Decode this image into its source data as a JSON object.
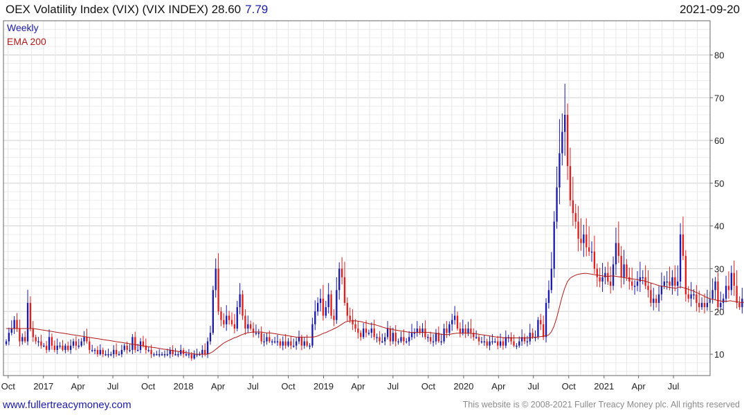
{
  "header": {
    "title": "OEX Volatility Index (VIX) (VIX INDEX) 28.60",
    "change": "7.79",
    "date": "2021-09-20"
  },
  "footer": {
    "site": "www.fullertreacymoney.com",
    "copyright": "This website is © 2008-2021 Fuller Treacy Money plc. All rights reserved"
  },
  "colors": {
    "up": "#1a1aa8",
    "down": "#dd1f1f",
    "ema": "#b01818",
    "grid": "#dcdcdc",
    "link": "#1a1aa8",
    "change": "#1a1aa8"
  },
  "chart_data": {
    "type": "candlestick",
    "legend": [
      {
        "label": "Weekly",
        "color": "#1a1aa8"
      },
      {
        "label": "EMA 200",
        "color": "#b01818"
      }
    ],
    "y_ticks": [
      10,
      20,
      30,
      40,
      50,
      60,
      70,
      80
    ],
    "ylim": [
      5,
      88
    ],
    "x_ticks": [
      "Oct",
      "2017",
      "Apr",
      "Jul",
      "Oct",
      "2018",
      "Apr",
      "Jul",
      "Oct",
      "2019",
      "Apr",
      "Jul",
      "Oct",
      "2020",
      "Apr",
      "Jul",
      "Oct",
      "2021",
      "Apr",
      "Jul"
    ],
    "grid": true,
    "x_start": "2016-09-26",
    "x_end": "2021-09-20",
    "weekly_close": [
      13,
      15,
      16,
      18,
      16,
      13,
      14,
      13,
      22,
      16,
      14,
      13,
      13,
      12,
      12,
      11,
      14,
      12,
      11,
      12,
      12,
      11,
      12,
      11,
      12,
      13,
      12,
      12,
      13,
      14,
      13,
      11,
      11,
      11,
      10,
      11,
      10,
      10,
      10,
      10,
      11,
      10,
      10,
      11,
      12,
      11,
      11,
      14,
      11,
      11,
      13,
      12,
      11,
      11,
      10,
      10,
      10,
      10,
      10,
      10,
      10,
      11,
      10,
      10,
      10,
      11,
      10,
      10,
      10,
      9,
      10,
      10,
      10,
      11,
      10,
      13,
      15,
      25,
      30,
      20,
      18,
      17,
      19,
      18,
      17,
      16,
      21,
      24,
      19,
      16,
      17,
      16,
      15,
      15,
      15,
      13,
      13,
      14,
      13,
      13,
      13,
      13,
      12,
      13,
      12,
      13,
      12,
      12,
      13,
      14,
      12,
      13,
      12,
      12,
      17,
      20,
      22,
      23,
      19,
      21,
      24,
      19,
      18,
      25,
      30,
      28,
      22,
      19,
      18,
      17,
      16,
      15,
      14,
      16,
      15,
      15,
      16,
      14,
      14,
      13,
      13,
      14,
      16,
      13,
      15,
      13,
      13,
      14,
      13,
      13,
      14,
      15,
      15,
      16,
      15,
      16,
      14,
      14,
      13,
      13,
      15,
      13,
      13,
      16,
      15,
      17,
      18,
      19,
      16,
      15,
      16,
      15,
      16,
      15,
      14,
      14,
      13,
      13,
      13,
      12,
      13,
      13,
      13,
      12,
      13,
      12,
      14,
      14,
      13,
      12,
      12,
      13,
      14,
      13,
      13,
      15,
      14,
      14,
      18,
      17,
      14,
      22,
      25,
      30,
      41,
      49,
      57,
      62,
      66,
      54,
      46,
      43,
      41,
      37,
      36,
      38,
      35,
      34,
      34,
      30,
      28,
      27,
      28,
      29,
      27,
      26,
      31,
      36,
      33,
      28,
      31,
      28,
      27,
      26,
      26,
      27,
      28,
      28,
      26,
      25,
      22,
      23,
      22,
      24,
      26,
      27,
      27,
      26,
      28,
      26,
      27,
      38,
      33,
      24,
      23,
      24,
      24,
      22,
      21,
      22,
      21,
      22,
      23,
      25,
      27,
      21,
      22,
      23,
      26,
      25,
      29,
      26,
      22,
      21,
      23,
      24,
      28,
      25,
      21,
      19,
      20,
      19,
      19,
      17,
      18,
      17,
      17,
      17,
      19,
      18,
      17,
      18,
      17,
      19,
      18,
      17,
      19,
      20,
      18,
      17,
      17,
      17,
      16,
      17,
      16,
      17,
      18,
      19,
      17,
      17,
      17,
      16,
      20,
      21,
      19,
      20,
      28.6
    ],
    "ema_200": [
      16,
      16,
      16,
      16,
      16,
      16,
      16,
      16,
      16,
      16,
      16,
      15.9,
      15.8,
      15.7,
      15.6,
      15.5,
      15.4,
      15.3,
      15.2,
      15.1,
      15,
      14.9,
      14.8,
      14.7,
      14.6,
      14.5,
      14.4,
      14.3,
      14.2,
      14.1,
      14,
      13.9,
      13.8,
      13.7,
      13.6,
      13.5,
      13.4,
      13.3,
      13.2,
      13.1,
      13,
      12.9,
      12.8,
      12.7,
      12.6,
      12.5,
      12.4,
      12.3,
      12.2,
      12.1,
      12,
      11.9,
      11.8,
      11.7,
      11.6,
      11.5,
      11.4,
      11.3,
      11.2,
      11.1,
      11,
      10.9,
      10.8,
      10.7,
      10.6,
      10.5,
      10.4,
      10.3,
      10.2,
      10.1,
      10,
      10,
      10,
      10,
      10,
      10.2,
      10.5,
      11,
      11.5,
      12,
      12.5,
      12.9,
      13.2,
      13.5,
      13.8,
      14,
      14.3,
      14.6,
      14.8,
      15,
      15.1,
      15.2,
      15.2,
      15.2,
      15.2,
      15.1,
      15,
      15,
      14.9,
      14.8,
      14.7,
      14.6,
      14.5,
      14.4,
      14.3,
      14.2,
      14.1,
      14,
      14,
      14,
      14,
      14,
      14,
      14,
      14.1,
      14.3,
      14.6,
      14.9,
      15.1,
      15.4,
      15.7,
      16,
      16.3,
      16.7,
      17.1,
      17.5,
      17.7,
      17.8,
      17.8,
      17.8,
      17.7,
      17.6,
      17.4,
      17.3,
      17.1,
      17,
      16.9,
      16.7,
      16.5,
      16.3,
      16.1,
      16,
      15.9,
      15.7,
      15.6,
      15.5,
      15.4,
      15.3,
      15.2,
      15.1,
      15.1,
      15.1,
      15.1,
      15.1,
      15.1,
      15.1,
      15.1,
      15,
      14.9,
      14.8,
      14.7,
      14.6,
      14.6,
      14.6,
      14.7,
      14.8,
      14.9,
      14.9,
      14.9,
      14.9,
      14.9,
      14.9,
      14.8,
      14.8,
      14.7,
      14.6,
      14.5,
      14.4,
      14.3,
      14.2,
      14.1,
      14,
      14,
      13.9,
      13.8,
      13.8,
      13.8,
      13.8,
      13.8,
      13.8,
      13.8,
      13.8,
      13.8,
      13.8,
      13.9,
      14,
      14,
      14.1,
      14.2,
      14.3,
      14.5,
      15.2,
      16.5,
      18.5,
      21,
      23.5,
      25.5,
      27,
      27.8,
      28.2,
      28.5,
      28.7,
      28.8,
      28.9,
      28.9,
      28.8,
      28.7,
      28.6,
      28.5,
      28.4,
      28.3,
      28.2,
      28.2,
      28.3,
      28.3,
      28.2,
      28.1,
      28,
      27.9,
      27.8,
      27.7,
      27.6,
      27.5,
      27.4,
      27.3,
      27.2,
      27,
      26.8,
      26.6,
      26.4,
      26.2,
      26,
      25.9,
      25.8,
      25.7,
      25.6,
      25.5,
      25.4,
      25.7,
      25.7,
      25.5,
      25.3,
      25.1,
      24.9,
      24.6,
      24.3,
      24,
      23.7,
      23.4,
      23.1,
      22.9,
      22.8,
      22.6,
      22.5,
      22.4,
      22.4,
      22.4,
      22.5,
      22.4,
      22.3,
      22.2,
      22.1,
      22.1,
      22.1,
      22,
      21.8,
      21.6,
      21.4,
      21.2,
      21,
      20.8,
      20.6,
      20.4,
      20.2,
      20.1,
      20,
      19.9,
      19.8,
      19.7,
      19.6,
      19.5,
      19.4,
      19.4,
      19.4,
      19.3,
      19.2,
      19.1,
      19,
      18.9,
      18.8,
      18.7,
      18.6,
      18.5,
      18.4,
      18.3,
      18.2,
      18.1,
      18,
      17.9,
      17.9,
      17.9,
      17.9,
      17.9,
      17.9
    ]
  }
}
